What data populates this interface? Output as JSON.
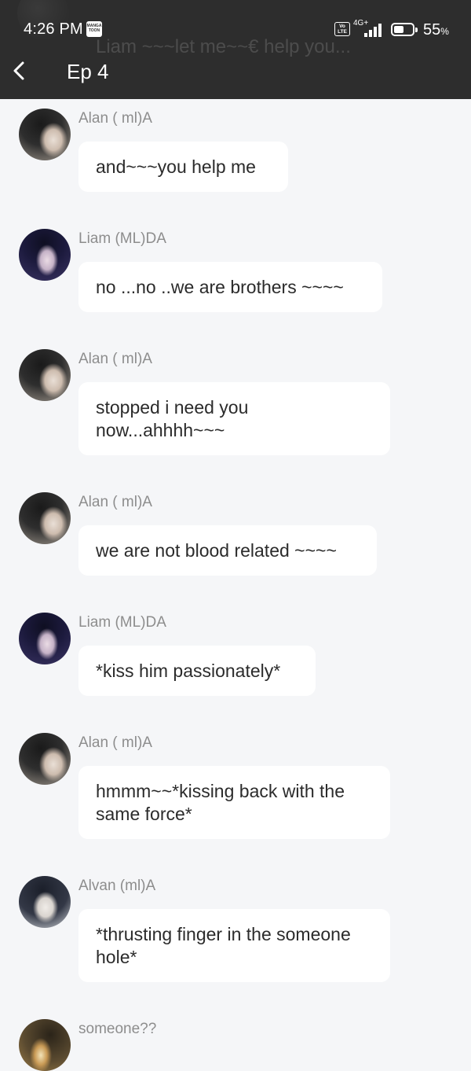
{
  "status_bar": {
    "time": "4:26 PM",
    "app_badge": "MANGA TOON",
    "volte": "Vo LTE",
    "network": "4G+",
    "battery_percent": 55,
    "battery_label": "55",
    "battery_unit": "%"
  },
  "header": {
    "back_icon": "chevron-left-icon",
    "title": "Ep 4",
    "ghost_message": {
      "text": "Liam ~~~let me~~€ help you..."
    }
  },
  "messages": [
    {
      "sender": "Alan ( ml)A",
      "avatar": "alan",
      "text": "and~~~you help me"
    },
    {
      "sender": "Liam (ML)DA",
      "avatar": "liam",
      "text": "no ...no ..we are brothers ~~~~"
    },
    {
      "sender": "Alan ( ml)A",
      "avatar": "alan",
      "text": "stopped i need you now...ahhhh~~~"
    },
    {
      "sender": "Alan ( ml)A",
      "avatar": "alan",
      "text": "we are not blood related ~~~~"
    },
    {
      "sender": "Liam (ML)DA",
      "avatar": "liam",
      "text": "*kiss him passionately*"
    },
    {
      "sender": "Alan ( ml)A",
      "avatar": "alan",
      "text": "hmmm~~*kissing back with the same force*"
    },
    {
      "sender": "Alvan (ml)A",
      "avatar": "alvan",
      "text": "*thrusting finger in the someone hole*"
    },
    {
      "sender": "someone??",
      "avatar": "someone",
      "text": ""
    }
  ],
  "colors": {
    "header_bg": "#2d2d2d",
    "page_bg": "#f5f6f8",
    "bubble_bg": "#ffffff",
    "name_text": "#8d8d8d",
    "message_text": "#2b2b2b"
  }
}
